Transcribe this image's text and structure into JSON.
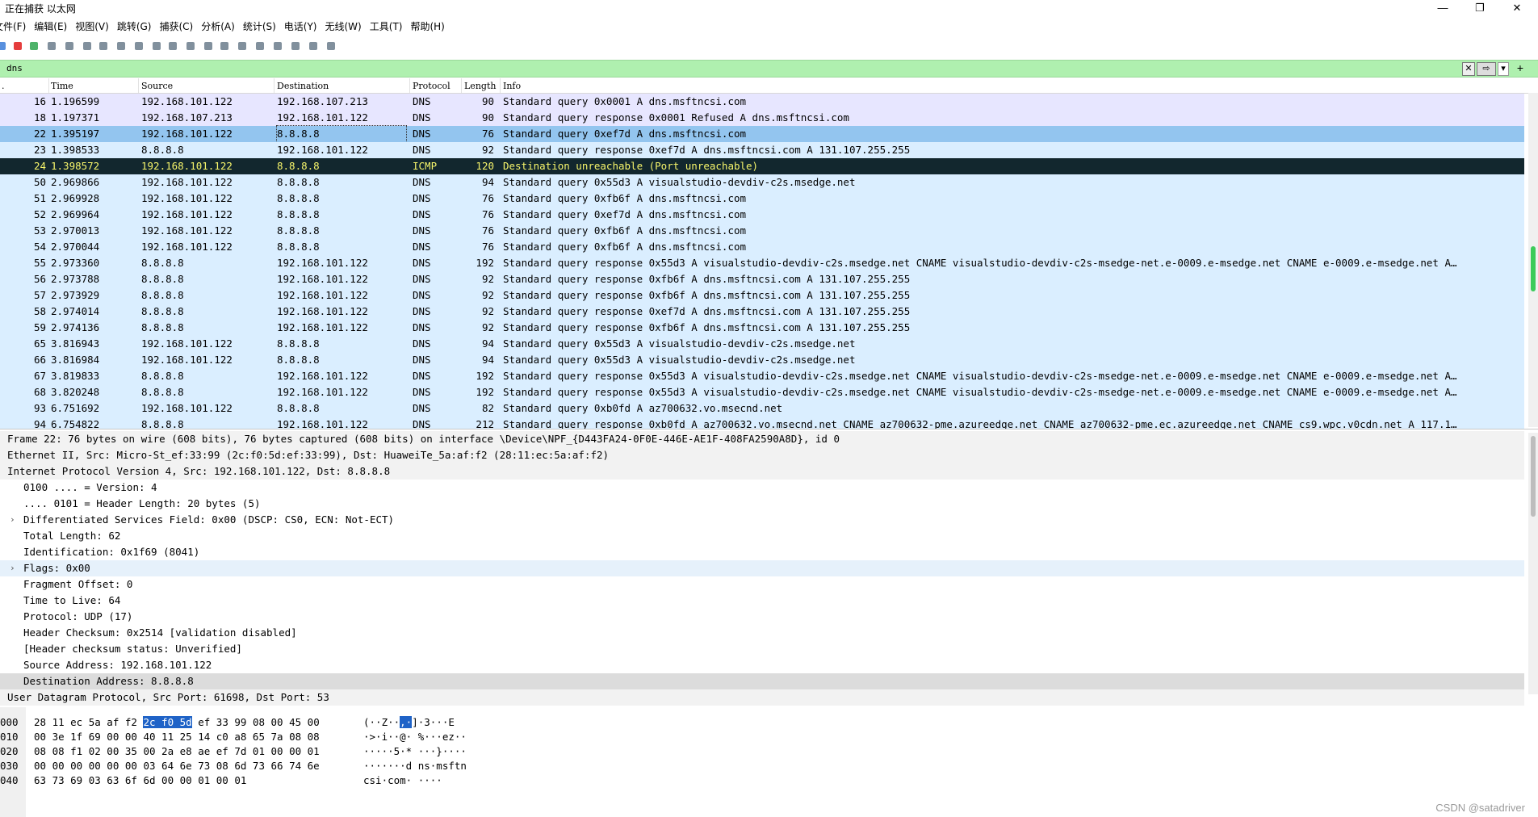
{
  "window": {
    "title": "正在捕获 以太网",
    "minimize": "—",
    "restore": "❐",
    "close": "✕"
  },
  "menu": [
    "文件(F)",
    "编辑(E)",
    "视图(V)",
    "跳转(G)",
    "捕获(C)",
    "分析(A)",
    "统计(S)",
    "电话(Y)",
    "无线(W)",
    "工具(T)",
    "帮助(H)"
  ],
  "toolbar_icons": [
    "shark-fin-icon",
    "stop-icon",
    "restart-icon",
    "options-icon",
    "open-icon",
    "save-icon",
    "close-file-icon",
    "reload-icon",
    "find-icon",
    "back-icon",
    "forward-icon",
    "goto-icon",
    "first-icon",
    "last-icon",
    "autoscroll-icon",
    "colorize-icon",
    "zoom-in-icon",
    "zoom-out-icon",
    "zoom-normal-icon",
    "resize-columns-icon"
  ],
  "filter": {
    "value": "dns",
    "clear": "✕",
    "apply": "⇨"
  },
  "columns": {
    "no": ".",
    "time": "Time",
    "source": "Source",
    "destination": "Destination",
    "protocol": "Protocol",
    "length": "Length",
    "info": "Info"
  },
  "colors": {
    "dns_row": "#daeeff",
    "selected_row": "#93c5ef",
    "icmp_error_bg": "#12272e",
    "icmp_error_fg": "#f7f56b",
    "first_rows": "#e7e6ff",
    "filter_bg": "#aff0af",
    "hex_select": "#1f63c7"
  },
  "packets": [
    {
      "no": "16",
      "time": "1.196599",
      "src": "192.168.101.122",
      "dst": "192.168.107.213",
      "proto": "DNS",
      "len": "90",
      "info": "Standard query 0x0001 A dns.msftncsi.com",
      "style": "first"
    },
    {
      "no": "18",
      "time": "1.197371",
      "src": "192.168.107.213",
      "dst": "192.168.101.122",
      "proto": "DNS",
      "len": "90",
      "info": "Standard query response 0x0001 Refused A dns.msftncsi.com",
      "style": "first"
    },
    {
      "no": "22",
      "time": "1.395197",
      "src": "192.168.101.122",
      "dst": "8.8.8.8",
      "proto": "DNS",
      "len": "76",
      "info": "Standard query 0xef7d A dns.msftncsi.com",
      "style": "selected"
    },
    {
      "no": "23",
      "time": "1.398533",
      "src": "8.8.8.8",
      "dst": "192.168.101.122",
      "proto": "DNS",
      "len": "92",
      "info": "Standard query response 0xef7d A dns.msftncsi.com A 131.107.255.255",
      "style": "dns"
    },
    {
      "no": "24",
      "time": "1.398572",
      "src": "192.168.101.122",
      "dst": "8.8.8.8",
      "proto": "ICMP",
      "len": "120",
      "info": "Destination unreachable (Port unreachable)",
      "style": "icmp"
    },
    {
      "no": "50",
      "time": "2.969866",
      "src": "192.168.101.122",
      "dst": "8.8.8.8",
      "proto": "DNS",
      "len": "94",
      "info": "Standard query 0x55d3 A visualstudio-devdiv-c2s.msedge.net",
      "style": "dns"
    },
    {
      "no": "51",
      "time": "2.969928",
      "src": "192.168.101.122",
      "dst": "8.8.8.8",
      "proto": "DNS",
      "len": "76",
      "info": "Standard query 0xfb6f A dns.msftncsi.com",
      "style": "dns"
    },
    {
      "no": "52",
      "time": "2.969964",
      "src": "192.168.101.122",
      "dst": "8.8.8.8",
      "proto": "DNS",
      "len": "76",
      "info": "Standard query 0xef7d A dns.msftncsi.com",
      "style": "dns"
    },
    {
      "no": "53",
      "time": "2.970013",
      "src": "192.168.101.122",
      "dst": "8.8.8.8",
      "proto": "DNS",
      "len": "76",
      "info": "Standard query 0xfb6f A dns.msftncsi.com",
      "style": "dns"
    },
    {
      "no": "54",
      "time": "2.970044",
      "src": "192.168.101.122",
      "dst": "8.8.8.8",
      "proto": "DNS",
      "len": "76",
      "info": "Standard query 0xfb6f A dns.msftncsi.com",
      "style": "dns"
    },
    {
      "no": "55",
      "time": "2.973360",
      "src": "8.8.8.8",
      "dst": "192.168.101.122",
      "proto": "DNS",
      "len": "192",
      "info": "Standard query response 0x55d3 A visualstudio-devdiv-c2s.msedge.net CNAME visualstudio-devdiv-c2s-msedge-net.e-0009.e-msedge.net CNAME e-0009.e-msedge.net A…",
      "style": "dns"
    },
    {
      "no": "56",
      "time": "2.973788",
      "src": "8.8.8.8",
      "dst": "192.168.101.122",
      "proto": "DNS",
      "len": "92",
      "info": "Standard query response 0xfb6f A dns.msftncsi.com A 131.107.255.255",
      "style": "dns"
    },
    {
      "no": "57",
      "time": "2.973929",
      "src": "8.8.8.8",
      "dst": "192.168.101.122",
      "proto": "DNS",
      "len": "92",
      "info": "Standard query response 0xfb6f A dns.msftncsi.com A 131.107.255.255",
      "style": "dns"
    },
    {
      "no": "58",
      "time": "2.974014",
      "src": "8.8.8.8",
      "dst": "192.168.101.122",
      "proto": "DNS",
      "len": "92",
      "info": "Standard query response 0xef7d A dns.msftncsi.com A 131.107.255.255",
      "style": "dns"
    },
    {
      "no": "59",
      "time": "2.974136",
      "src": "8.8.8.8",
      "dst": "192.168.101.122",
      "proto": "DNS",
      "len": "92",
      "info": "Standard query response 0xfb6f A dns.msftncsi.com A 131.107.255.255",
      "style": "dns"
    },
    {
      "no": "65",
      "time": "3.816943",
      "src": "192.168.101.122",
      "dst": "8.8.8.8",
      "proto": "DNS",
      "len": "94",
      "info": "Standard query 0x55d3 A visualstudio-devdiv-c2s.msedge.net",
      "style": "dns"
    },
    {
      "no": "66",
      "time": "3.816984",
      "src": "192.168.101.122",
      "dst": "8.8.8.8",
      "proto": "DNS",
      "len": "94",
      "info": "Standard query 0x55d3 A visualstudio-devdiv-c2s.msedge.net",
      "style": "dns"
    },
    {
      "no": "67",
      "time": "3.819833",
      "src": "8.8.8.8",
      "dst": "192.168.101.122",
      "proto": "DNS",
      "len": "192",
      "info": "Standard query response 0x55d3 A visualstudio-devdiv-c2s.msedge.net CNAME visualstudio-devdiv-c2s-msedge-net.e-0009.e-msedge.net CNAME e-0009.e-msedge.net A…",
      "style": "dns"
    },
    {
      "no": "68",
      "time": "3.820248",
      "src": "8.8.8.8",
      "dst": "192.168.101.122",
      "proto": "DNS",
      "len": "192",
      "info": "Standard query response 0x55d3 A visualstudio-devdiv-c2s.msedge.net CNAME visualstudio-devdiv-c2s-msedge-net.e-0009.e-msedge.net CNAME e-0009.e-msedge.net A…",
      "style": "dns"
    },
    {
      "no": "93",
      "time": "6.751692",
      "src": "192.168.101.122",
      "dst": "8.8.8.8",
      "proto": "DNS",
      "len": "82",
      "info": "Standard query 0xb0fd A az700632.vo.msecnd.net",
      "style": "dns"
    },
    {
      "no": "94",
      "time": "6.754822",
      "src": "8.8.8.8",
      "dst": "192.168.101.122",
      "proto": "DNS",
      "len": "212",
      "info": "Standard query response 0xb0fd A az700632.vo.msecnd.net CNAME az700632-pme.azureedge.net CNAME az700632-pme.ec.azureedge.net CNAME cs9.wpc.v0cdn.net A 117.1…",
      "style": "dns"
    }
  ],
  "details": [
    {
      "text": "Frame 22: 76 bytes on wire (608 bits), 76 bytes captured (608 bits) on interface \\Device\\NPF_{D443FA24-0F0E-446E-AE1F-408FA2590A8D}, id 0",
      "indent": 0,
      "bg": "#f2f2f2",
      "exp": ""
    },
    {
      "text": "Ethernet II, Src: Micro-St_ef:33:99 (2c:f0:5d:ef:33:99), Dst: HuaweiTe_5a:af:f2 (28:11:ec:5a:af:f2)",
      "indent": 0,
      "bg": "#f2f2f2",
      "exp": ""
    },
    {
      "text": "Internet Protocol Version 4, Src: 192.168.101.122, Dst: 8.8.8.8",
      "indent": 0,
      "bg": "#f2f2f2",
      "exp": ""
    },
    {
      "text": "0100 .... = Version: 4",
      "indent": 1,
      "bg": "#ffffff",
      "exp": ""
    },
    {
      "text": ".... 0101 = Header Length: 20 bytes (5)",
      "indent": 1,
      "bg": "#ffffff",
      "exp": ""
    },
    {
      "text": "Differentiated Services Field: 0x00 (DSCP: CS0, ECN: Not-ECT)",
      "indent": 1,
      "bg": "#ffffff",
      "exp": "›"
    },
    {
      "text": "Total Length: 62",
      "indent": 1,
      "bg": "#ffffff",
      "exp": ""
    },
    {
      "text": "Identification: 0x1f69 (8041)",
      "indent": 1,
      "bg": "#ffffff",
      "exp": ""
    },
    {
      "text": "Flags: 0x00",
      "indent": 1,
      "bg": "#e6f1fb",
      "exp": "›"
    },
    {
      "text": "Fragment Offset: 0",
      "indent": 1,
      "bg": "#ffffff",
      "exp": ""
    },
    {
      "text": "Time to Live: 64",
      "indent": 1,
      "bg": "#ffffff",
      "exp": ""
    },
    {
      "text": "Protocol: UDP (17)",
      "indent": 1,
      "bg": "#ffffff",
      "exp": ""
    },
    {
      "text": "Header Checksum: 0x2514 [validation disabled]",
      "indent": 1,
      "bg": "#ffffff",
      "exp": ""
    },
    {
      "text": "[Header checksum status: Unverified]",
      "indent": 1,
      "bg": "#ffffff",
      "exp": ""
    },
    {
      "text": "Source Address: 192.168.101.122",
      "indent": 1,
      "bg": "#ffffff",
      "exp": ""
    },
    {
      "text": "Destination Address: 8.8.8.8",
      "indent": 1,
      "bg": "#dcdcdc",
      "exp": ""
    },
    {
      "text": "User Datagram Protocol, Src Port: 61698, Dst Port: 53",
      "indent": 0,
      "bg": "#f2f2f2",
      "exp": ""
    }
  ],
  "hex": [
    {
      "off": "000",
      "pre": "28 11 ec 5a af f2 ",
      "sel": "2c f0  5d",
      "post": " ef 33 99 08 00 45 00",
      "apre": "(··Z··",
      "asel": ",·",
      "apost": "]·3···E"
    },
    {
      "off": "010",
      "pre": "00 3e 1f 69 00 00 40 11  25 14 c0 a8 65 7a 08 08",
      "sel": "",
      "post": "",
      "apre": "·>·i··@· %···ez··",
      "asel": "",
      "apost": ""
    },
    {
      "off": "020",
      "pre": "08 08 f1 02 00 35 00 2a  e8 ae ef 7d 01 00 00 01",
      "sel": "",
      "post": "",
      "apre": "·····5·* ···}····",
      "asel": "",
      "apost": ""
    },
    {
      "off": "030",
      "pre": "00 00 00 00 00 00 03 64  6e 73 08 6d 73 66 74 6e",
      "sel": "",
      "post": "",
      "apre": "·······d ns·msftn",
      "asel": "",
      "apost": ""
    },
    {
      "off": "040",
      "pre": "63 73 69 03 63 6f 6d 00  00 01 00 01",
      "sel": "",
      "post": "",
      "apre": "csi·com· ····",
      "asel": "",
      "apost": ""
    }
  ],
  "watermark": "CSDN @satadriver"
}
